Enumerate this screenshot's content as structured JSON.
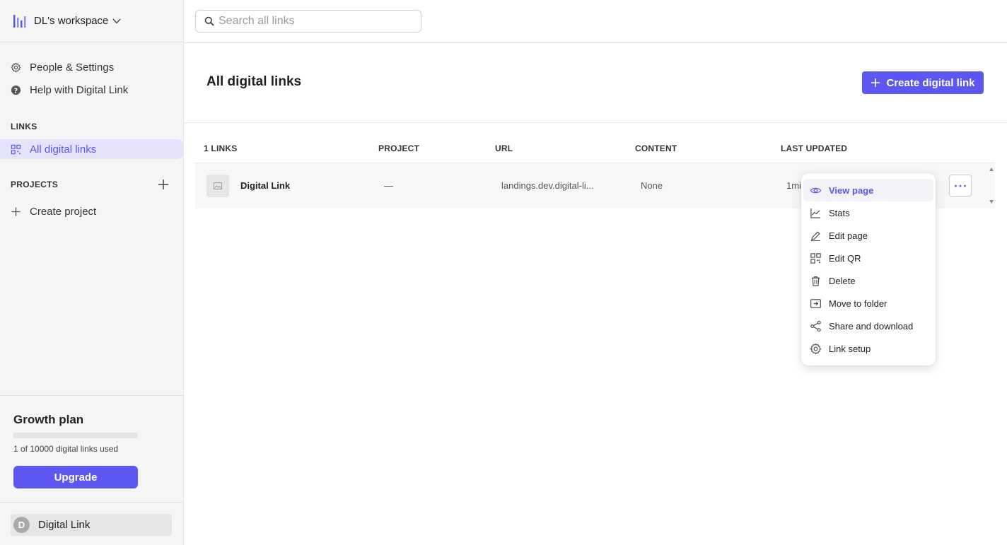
{
  "workspace": {
    "name": "DL's workspace"
  },
  "nav": {
    "people_settings": "People & Settings",
    "help": "Help with Digital Link"
  },
  "links_section": {
    "label": "LINKS",
    "all_links": "All digital links"
  },
  "projects_section": {
    "label": "PROJECTS",
    "create_project": "Create project"
  },
  "plan": {
    "title": "Growth plan",
    "usage_text": "1 of 10000 digital links used",
    "usage_fraction": 0.0001,
    "upgrade_label": "Upgrade"
  },
  "user": {
    "initial": "D",
    "name": "Digital Link"
  },
  "search": {
    "placeholder": "Search all links"
  },
  "main": {
    "title": "All digital links",
    "create_label": "Create digital link"
  },
  "table": {
    "headers": {
      "links": "1 LINKS",
      "project": "PROJECT",
      "url": "URL",
      "content": "CONTENT",
      "updated": "LAST UPDATED"
    },
    "rows": [
      {
        "name": "Digital Link",
        "project": "—",
        "url": "landings.dev.digital-li...",
        "content": "None",
        "updated": "1mi"
      }
    ]
  },
  "menu": {
    "items": [
      {
        "label": "View page",
        "icon": "eye-icon"
      },
      {
        "label": "Stats",
        "icon": "chart-icon"
      },
      {
        "label": "Edit page",
        "icon": "pencil-icon"
      },
      {
        "label": "Edit QR",
        "icon": "qr-icon"
      },
      {
        "label": "Delete",
        "icon": "trash-icon"
      },
      {
        "label": "Move to folder",
        "icon": "move-folder-icon"
      },
      {
        "label": "Share and download",
        "icon": "share-icon"
      },
      {
        "label": "Link setup",
        "icon": "gear-icon"
      }
    ]
  },
  "colors": {
    "accent": "#5d57f1",
    "active_bg": "#e4e3fa",
    "sidebar_bg": "#f5f5f5"
  }
}
